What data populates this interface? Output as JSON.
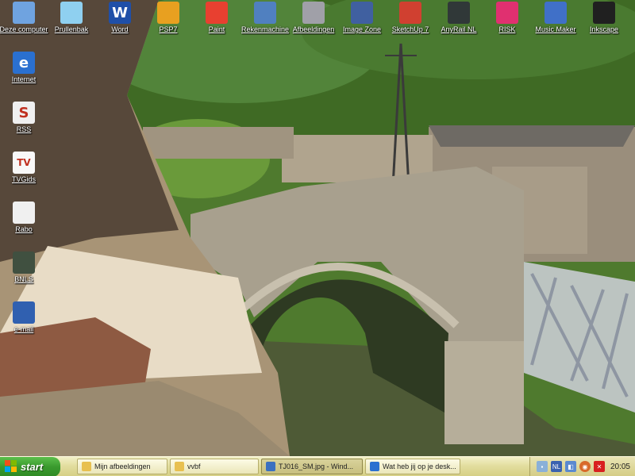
{
  "desktop": {
    "icons": [
      {
        "label": "Deze computer",
        "icon": "my-computer-icon",
        "color": "#6fa3e0"
      },
      {
        "label": "Prullenbak",
        "icon": "recycle-bin-icon",
        "color": "#8fd0f0"
      },
      {
        "label": "Word",
        "icon": "word-icon",
        "color": "#1f4fa8",
        "glyph": "W"
      },
      {
        "label": "PSP7",
        "icon": "psp-icon",
        "color": "#e8a020"
      },
      {
        "label": "Paint",
        "icon": "paint-icon",
        "color": "#e84030"
      },
      {
        "label": "Rekenmachine",
        "icon": "calculator-icon",
        "color": "#5080c0"
      },
      {
        "label": "Afbeeldingen",
        "icon": "camera-icon",
        "color": "#a0a0a8"
      },
      {
        "label": "Image Zone",
        "icon": "image-zone-icon",
        "color": "#4060a0"
      },
      {
        "label": "SketchUp 7",
        "icon": "sketchup-icon",
        "color": "#d04030"
      },
      {
        "label": "AnyRail NL",
        "icon": "anyrail-icon",
        "color": "#303838"
      },
      {
        "label": "RISK",
        "icon": "risk-icon",
        "color": "#e03070"
      },
      {
        "label": "Music Maker",
        "icon": "music-maker-icon",
        "color": "#4070c8"
      },
      {
        "label": "Inkscape",
        "icon": "inkscape-icon",
        "color": "#202020"
      },
      {
        "label": "Internet",
        "icon": "internet-explorer-icon",
        "color": "#2a70d0",
        "glyph": "e"
      },
      {
        "label": "RSS",
        "icon": "rss-icon",
        "color": "#f0f0f0",
        "glyph": "S"
      },
      {
        "label": "TVGids",
        "icon": "tvgids-icon",
        "color": "#f8f8f8",
        "glyph": "TV"
      },
      {
        "label": "Rabo",
        "icon": "rabo-icon",
        "color": "#f0f0f0"
      },
      {
        "label": "BNLS",
        "icon": "bnls-icon",
        "color": "#405040"
      },
      {
        "label": "e-mail",
        "icon": "email-icon",
        "color": "#3060b0"
      }
    ]
  },
  "taskbar": {
    "start_label": "start",
    "buttons": [
      {
        "label": "Mijn afbeeldingen",
        "icon": "folder-icon",
        "color": "#e8c050"
      },
      {
        "label": "vvbf",
        "icon": "folder-icon",
        "color": "#e8c050"
      },
      {
        "label": "TJ016_SM.jpg - Wind...",
        "icon": "image-viewer-icon",
        "color": "#3a70c0"
      },
      {
        "label": "Wat heb jij op je desk...",
        "icon": "internet-explorer-icon",
        "color": "#2a70d0"
      }
    ],
    "tray": {
      "language": "NL",
      "clock": "20:05"
    }
  }
}
